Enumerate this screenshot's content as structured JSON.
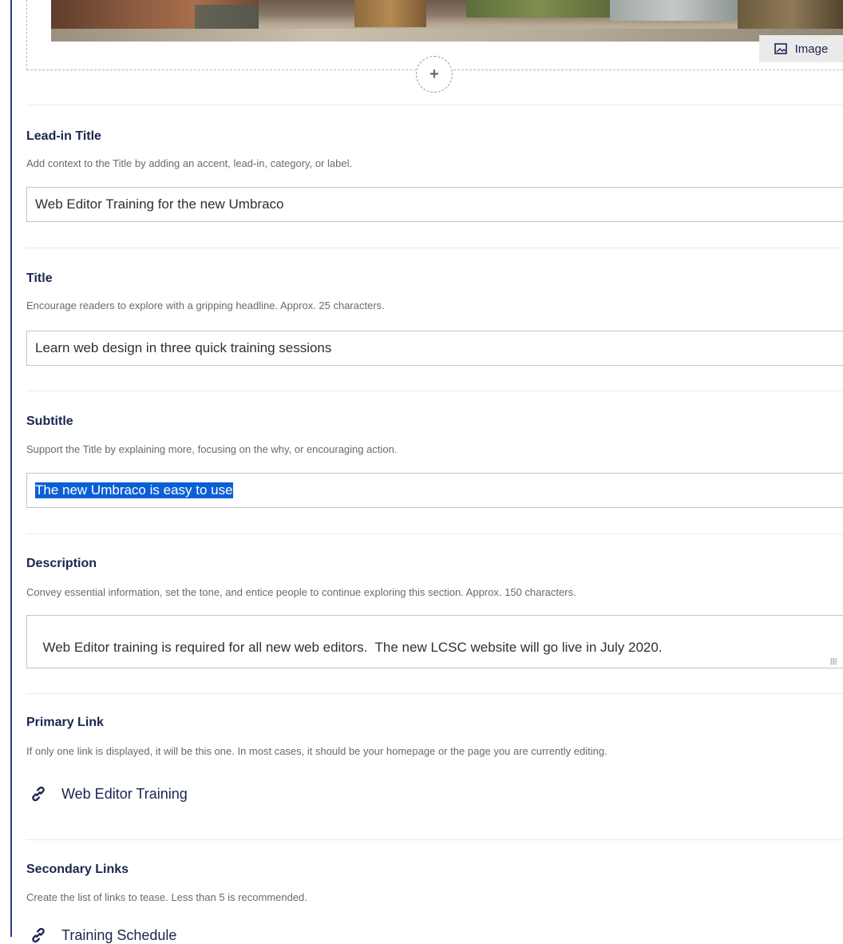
{
  "media": {
    "badge_label": "Image",
    "add_symbol": "+"
  },
  "fields": {
    "lead_in": {
      "label": "Lead-in Title",
      "description": "Add context to the Title by adding an accent, lead-in, category, or label.",
      "value": "Web Editor Training for the new Umbraco"
    },
    "title": {
      "label": "Title",
      "description": "Encourage readers to explore with a gripping headline. Approx. 25 characters.",
      "value": "Learn web design in three quick training sessions"
    },
    "subtitle": {
      "label": "Subtitle",
      "description": "Support the Title by explaining more, focusing on the why, or encouraging action.",
      "value": "The new Umbraco is easy to use"
    },
    "description": {
      "label": "Description",
      "description": "Convey essential information, set the tone, and entice people to continue exploring this section. Approx. 150 characters.",
      "value": "Web Editor training is required for all new web editors.  The new LCSC website will go live in July 2020."
    },
    "primary_link": {
      "label": "Primary Link",
      "description": "If only one link is displayed, it will be this one. In most cases, it should be your homepage or the page you are currently editing.",
      "link_text": "Web Editor Training"
    },
    "secondary_links": {
      "label": "Secondary Links",
      "description": "Create the list of links to tease. Less than 5 is recommended.",
      "first_link_text": "Training Schedule"
    }
  },
  "icons": {
    "image": "image-icon",
    "link": "link-icon",
    "add": "plus-icon"
  },
  "colors": {
    "label": "#1b264f",
    "selection": "#0b5fd6",
    "frame": "#2b3a8c"
  }
}
